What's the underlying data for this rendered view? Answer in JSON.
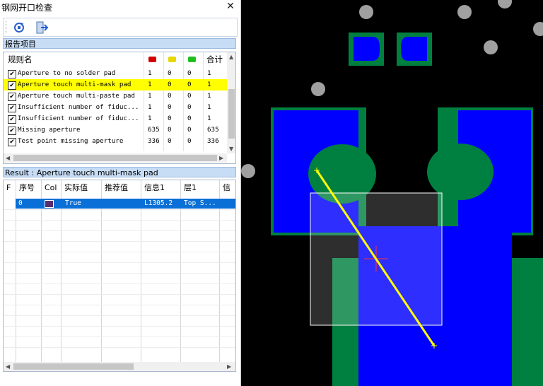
{
  "window": {
    "title": "钢网开口检查",
    "close_glyph": "✕"
  },
  "toolbar": {
    "icons": [
      "refresh-icon",
      "exit-icon"
    ]
  },
  "report_section": {
    "title": "报告项目"
  },
  "rules_table": {
    "headers": {
      "name": "规则名",
      "total": "合计"
    },
    "indicator_colors": [
      "#d40000",
      "#e6d800",
      "#1fbf1f"
    ],
    "rows": [
      {
        "checked": true,
        "name": "Aperture to no solder pad",
        "c1": "1",
        "c2": "0",
        "c3": "0",
        "total": "1",
        "highlight": false
      },
      {
        "checked": true,
        "name": "Aperture touch multi-mask pad",
        "c1": "1",
        "c2": "0",
        "c3": "0",
        "total": "1",
        "highlight": true
      },
      {
        "checked": true,
        "name": "Aperture touch multi-paste pad",
        "c1": "1",
        "c2": "0",
        "c3": "0",
        "total": "1",
        "highlight": false
      },
      {
        "checked": true,
        "name": "Insufficient number of fiduc...",
        "c1": "1",
        "c2": "0",
        "c3": "0",
        "total": "1",
        "highlight": false
      },
      {
        "checked": true,
        "name": "Insufficient number of fiduc...",
        "c1": "1",
        "c2": "0",
        "c3": "0",
        "total": "1",
        "highlight": false
      },
      {
        "checked": true,
        "name": "Missing aperture",
        "c1": "635",
        "c2": "0",
        "c3": "0",
        "total": "635",
        "highlight": false
      },
      {
        "checked": true,
        "name": "Test point missing aperture",
        "c1": "336",
        "c2": "0",
        "c3": "0",
        "total": "336",
        "highlight": false
      }
    ]
  },
  "result_section": {
    "title": "Result : Aperture touch multi-mask pad"
  },
  "result_grid": {
    "headers": [
      "F",
      "序号",
      "Col",
      "实际值",
      "推荐值",
      "信息1",
      "层1",
      "信息"
    ],
    "rows": [
      {
        "index": "0",
        "col_color": "#5a2d6e",
        "actual": "True",
        "recommended": "",
        "info1": "L1305.2",
        "layer1": "Top S..."
      }
    ]
  },
  "colors": {
    "selection": "#0a6fd6",
    "highlight": "#ffff00",
    "section_header": "#c7dcf5",
    "pad_blue": "#0000ff",
    "mask_green": "#007a3a",
    "measure_line": "#ffff00"
  }
}
